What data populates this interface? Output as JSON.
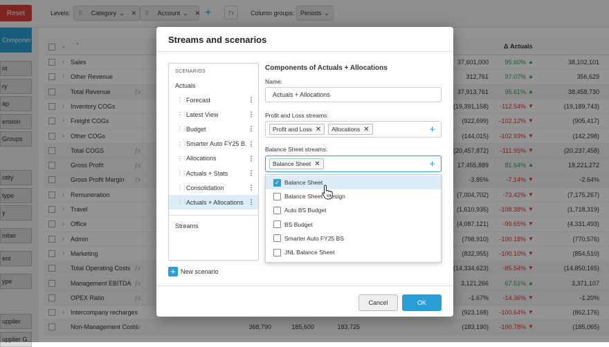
{
  "toolbar": {
    "reset_label": "Reset",
    "levels_label": "Levels:",
    "levels": [
      "Category",
      "Account"
    ],
    "fx_label": "ƒx",
    "column_groups_label": "Column groups:",
    "periods_label": "Periods"
  },
  "left_panel": {
    "items": [
      {
        "label": "Components (... ry",
        "active": true
      },
      {
        "label": "nt"
      },
      {
        "label": "ry"
      },
      {
        "label": "ap"
      },
      {
        "label": "ension"
      },
      {
        "label": "Groups"
      },
      {
        "label": "ntity"
      },
      {
        "label": "type"
      },
      {
        "label": "y"
      },
      {
        "label": "mber"
      },
      {
        "label": "ent"
      },
      {
        "label": "ype"
      },
      {
        "label": "upplier"
      },
      {
        "label": "upplier G..."
      }
    ]
  },
  "grid": {
    "actuals_header": "Δ Actuals",
    "rows": [
      {
        "name": "Sales",
        "c1": "",
        "c2": "",
        "c3": "",
        "a": "37,601,000",
        "p": "95.60%",
        "dir": "up",
        "b": "38,102,101"
      },
      {
        "name": "Other Revenue",
        "c1": "",
        "c2": "",
        "c3": "",
        "a": "312,761",
        "p": "97.07%",
        "dir": "up",
        "b": "356,629"
      },
      {
        "name": "Total Revenue",
        "fx": true,
        "c1": "",
        "c2": "",
        "c3": "",
        "a": "37,913,761",
        "p": "95.61%",
        "dir": "up",
        "b": "38,458,730"
      },
      {
        "name": "Inventory COGs",
        "c1": "",
        "c2": "",
        "c3": "",
        "a": "(19,391,158)",
        "p": "-112.54%",
        "dir": "down",
        "b": "(19,189,743)"
      },
      {
        "name": "Freight COGs",
        "c1": "",
        "c2": "",
        "c3": "",
        "a": "(922,699)",
        "p": "-102.12%",
        "dir": "down",
        "b": "(905,417)"
      },
      {
        "name": "Other COGs",
        "c1": "",
        "c2": "",
        "c3": "",
        "a": "(144,015)",
        "p": "-102.93%",
        "dir": "down",
        "b": "(142,298)"
      },
      {
        "name": "Total COGS",
        "fx": true,
        "c1": "",
        "c2": "",
        "c3": "",
        "a": "(20,457,872)",
        "p": "-111.95%",
        "dir": "down",
        "b": "(20,237,458)"
      },
      {
        "name": "Gross Profit",
        "fx": true,
        "c1": "",
        "c2": "",
        "c3": "",
        "a": "17,455,889",
        "p": "81.64%",
        "dir": "up",
        "b": "18,221,272"
      },
      {
        "name": "Gross Profit Margin",
        "fx": true,
        "c1": "",
        "c2": "",
        "c3": "",
        "a": "-3.85%",
        "p": "-7.14%",
        "dir": "down",
        "b": "-2.64%"
      },
      {
        "name": "Remuneration",
        "c1": "",
        "c2": "",
        "c3": "",
        "a": "(7,004,702)",
        "p": "-73.42%",
        "dir": "down",
        "b": "(7,175,267)"
      },
      {
        "name": "Travel",
        "c1": "",
        "c2": "",
        "c3": "",
        "a": "(1,610,935)",
        "p": "-108.38%",
        "dir": "down",
        "b": "(1,718,319)"
      },
      {
        "name": "Office",
        "c1": "",
        "c2": "",
        "c3": "",
        "a": "(4,087,121)",
        "p": "-99.65%",
        "dir": "down",
        "b": "(4,331,493)"
      },
      {
        "name": "Admin",
        "c1": "",
        "c2": "",
        "c3": "",
        "a": "(798,910)",
        "p": "-100.18%",
        "dir": "down",
        "b": "(770,576)"
      },
      {
        "name": "Marketing",
        "c1": "",
        "c2": "",
        "c3": "",
        "a": "(832,955)",
        "p": "-100.10%",
        "dir": "down",
        "b": "(854,510)"
      },
      {
        "name": "Total Operating Costs",
        "fx": true,
        "c1": "",
        "c2": "",
        "c3": "",
        "a": "(14,334,623)",
        "p": "-85.54%",
        "dir": "down",
        "b": "(14,850,165)"
      },
      {
        "name": "Management EBITDA",
        "fx": true,
        "c1": "",
        "c2": "",
        "c3": "",
        "a": "3,121,266",
        "p": "67.51%",
        "dir": "up",
        "b": "3,371,107"
      },
      {
        "name": "OPEX Ratio",
        "fx": true,
        "c1": "",
        "c2": "",
        "c3": "",
        "a": "-1.67%",
        "p": "-14.36%",
        "dir": "down",
        "b": "-1.20%"
      },
      {
        "name": "Intercompany recharges",
        "c1": "",
        "c2": "",
        "c3": "",
        "a": "(923,168)",
        "p": "-100.64%",
        "dir": "down",
        "b": "(862,176)"
      },
      {
        "name": "Non-Management Costs",
        "fx": true,
        "c1": "368,790",
        "c2": "185,600",
        "c3": "183,725",
        "a": "(183,190)",
        "p": "-100.78%",
        "dir": "down",
        "b": "(185,065)"
      }
    ]
  },
  "dialog": {
    "title": "Streams and scenarios",
    "scenarios_header": "SCENARIOS",
    "actuals_label": "Actuals",
    "scenarios": [
      "Forecast",
      "Latest View",
      "Budget",
      "Smarter Auto FY25 B...",
      "Allocations",
      "Actuals + Stats",
      "Consolidation",
      "Actuals + Allocations"
    ],
    "selected_scenario": "Actuals + Allocations",
    "streams_label": "Streams",
    "new_scenario_label": "New scenario",
    "components_title": "Components of Actuals + Allocations",
    "name_label": "Name:",
    "name_value": "Actuals + Allocations",
    "pl_streams_label": "Profit and Loss streams:",
    "pl_streams": [
      "Profit and Loss",
      "Allocations"
    ],
    "bs_streams_label": "Balance Sheet streams:",
    "bs_streams": [
      "Balance Sheet"
    ],
    "dropdown_options": [
      {
        "label": "Balance Sheet",
        "checked": true
      },
      {
        "label": "Balance Sheet - design",
        "checked": false
      },
      {
        "label": "Auto BS Budget",
        "checked": false
      },
      {
        "label": "BS Budget",
        "checked": false
      },
      {
        "label": "Smarter Auto FY25 BS",
        "checked": false
      },
      {
        "label": "JNL Balance Sheet",
        "checked": false
      }
    ],
    "cancel_label": "Cancel",
    "ok_label": "OK"
  },
  "colors": {
    "accent": "#2a9fd6",
    "reset": "#d9403b",
    "up": "#2e9b54",
    "down": "#dd3333"
  }
}
